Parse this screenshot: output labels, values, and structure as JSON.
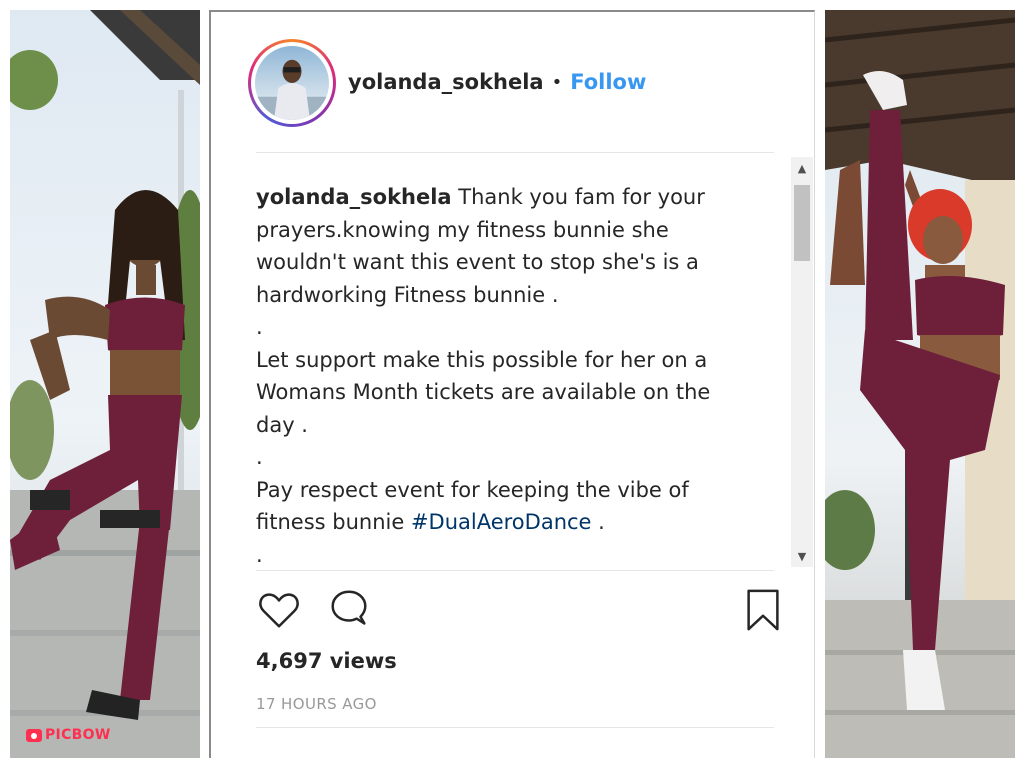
{
  "post": {
    "username": "yolanda_sokhela",
    "separator": "•",
    "follow_label": "Follow",
    "caption": {
      "username": "yolanda_sokhela",
      "line1": "Thank you fam for your",
      "line2": "prayers.knowing my fitness bunnie she",
      "line3": "wouldn't want this event to stop she's is a",
      "line4": "hardworking Fitness bunnie .",
      "dot1": ".",
      "line5": "Let support make this possible for her on a",
      "line6": "Womans Month tickets are available on the",
      "line7": "day .",
      "dot2": ".",
      "line8": "Pay respect event for keeping the vibe of",
      "line9_text": "fitness bunnie ",
      "hashtag": "#DualAeroDance",
      "line9_end": " .",
      "dot3": "."
    },
    "views": "4,697 views",
    "time": "17 HOURS AGO"
  },
  "icons": {
    "like": "heart-icon",
    "comment": "comment-icon",
    "save": "bookmark-icon",
    "scroll_up": "scroll-up-arrow-icon",
    "scroll_down": "scroll-down-arrow-icon"
  },
  "watermark": {
    "text": "PICBOW",
    "color": "#ff2f4f"
  },
  "colors": {
    "follow": "#3897f0",
    "hashtag": "#003569",
    "text": "#262626",
    "muted": "#999999"
  }
}
